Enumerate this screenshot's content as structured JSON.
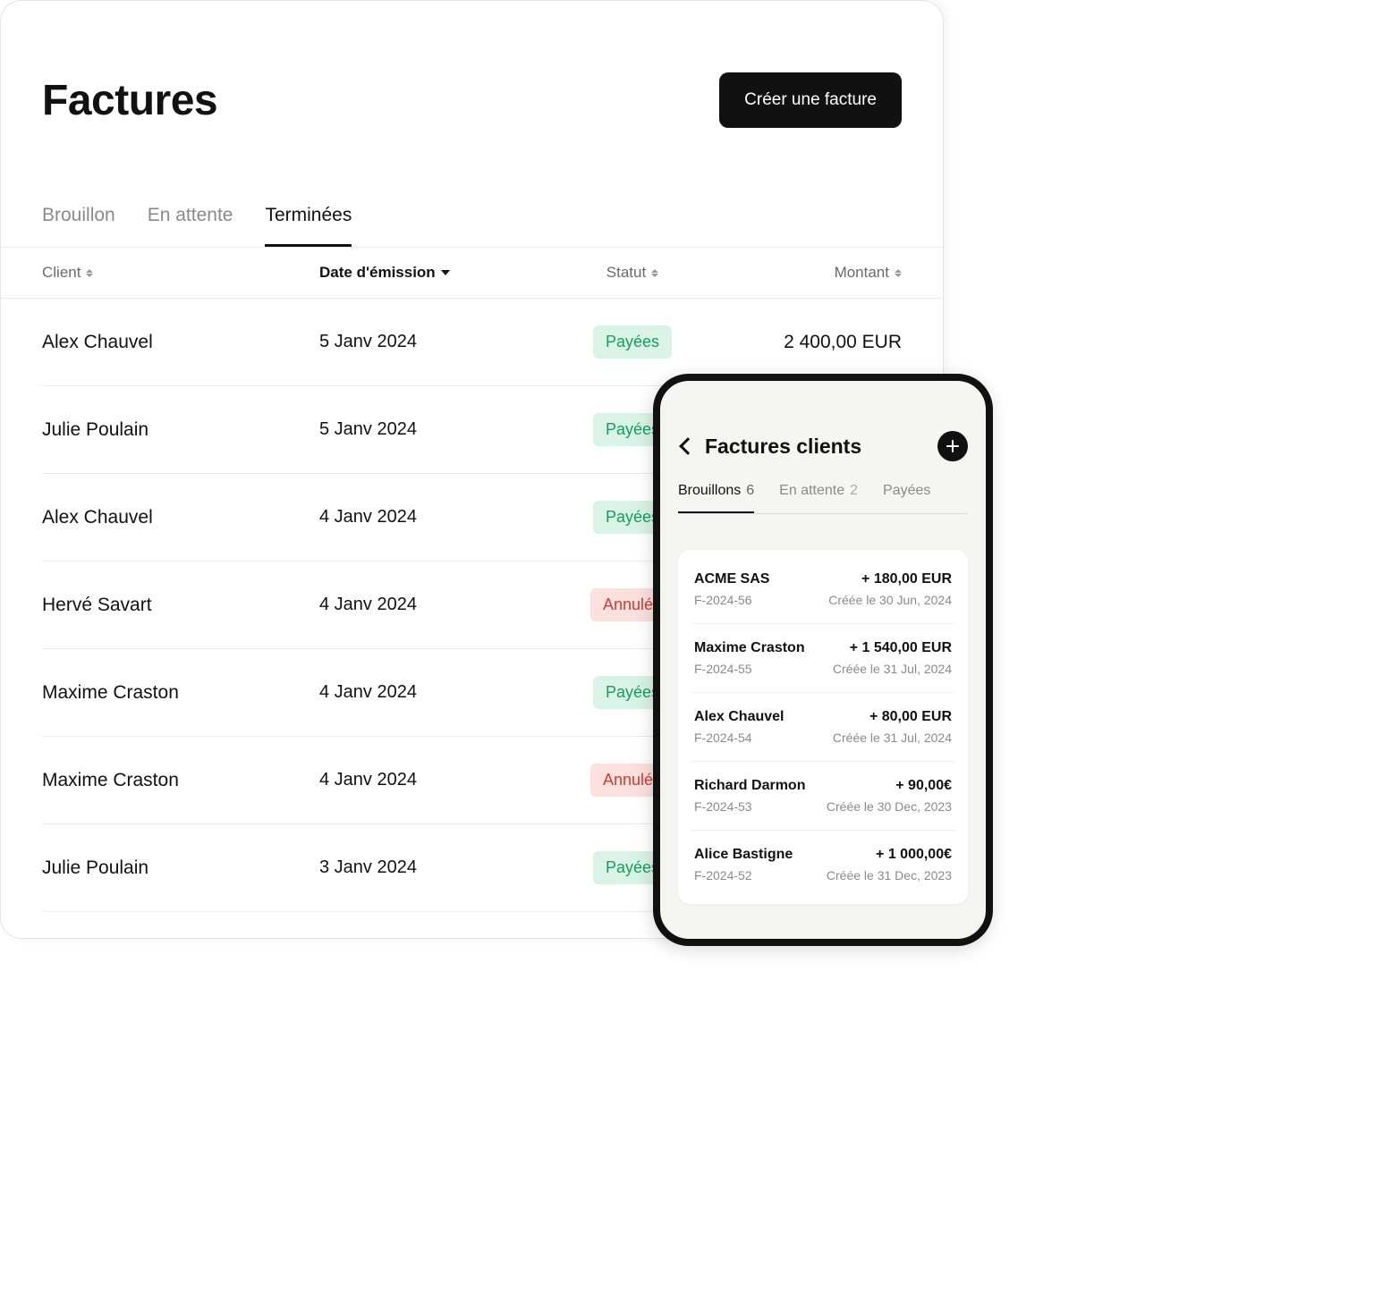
{
  "desktop": {
    "title": "Factures",
    "create_button": "Créer une facture",
    "tabs": [
      {
        "label": "Brouillon",
        "active": false
      },
      {
        "label": "En attente",
        "active": false
      },
      {
        "label": "Terminées",
        "active": true
      }
    ],
    "columns": {
      "client": "Client",
      "date": "Date d'émission",
      "status": "Statut",
      "amount": "Montant"
    },
    "status_labels": {
      "paid": "Payées",
      "cancelled": "Annulée"
    },
    "rows": [
      {
        "client": "Alex Chauvel",
        "date": "5 Janv 2024",
        "status": "paid",
        "amount": "2 400,00 EUR"
      },
      {
        "client": "Julie Poulain",
        "date": "5 Janv 2024",
        "status": "paid",
        "amount": ""
      },
      {
        "client": "Alex Chauvel",
        "date": "4 Janv 2024",
        "status": "paid",
        "amount": ""
      },
      {
        "client": "Hervé Savart",
        "date": "4 Janv 2024",
        "status": "cancelled",
        "amount": ""
      },
      {
        "client": "Maxime Craston",
        "date": "4 Janv 2024",
        "status": "paid",
        "amount": ""
      },
      {
        "client": "Maxime Craston",
        "date": "4 Janv 2024",
        "status": "cancelled",
        "amount": ""
      },
      {
        "client": "Julie Poulain",
        "date": "3 Janv 2024",
        "status": "paid",
        "amount": ""
      }
    ]
  },
  "mobile": {
    "title": "Factures clients",
    "tabs": [
      {
        "label": "Brouillons",
        "count": "6",
        "active": true
      },
      {
        "label": "En attente",
        "count": "2",
        "active": false
      },
      {
        "label": "Payées",
        "count": "",
        "active": false
      }
    ],
    "rows": [
      {
        "client": "ACME SAS",
        "amount": "+ 180,00 EUR",
        "ref": "F-2024-56",
        "date": "Créée le 30 Jun, 2024"
      },
      {
        "client": "Maxime Craston",
        "amount": "+ 1 540,00 EUR",
        "ref": "F-2024-55",
        "date": "Créée le 31 Jul, 2024"
      },
      {
        "client": "Alex Chauvel",
        "amount": "+ 80,00 EUR",
        "ref": "F-2024-54",
        "date": "Créée le 31 Jul, 2024"
      },
      {
        "client": "Richard Darmon",
        "amount": "+ 90,00€",
        "ref": "F-2024-53",
        "date": "Créée le 30 Dec, 2023"
      },
      {
        "client": "Alice Bastigne",
        "amount": "+ 1 000,00€",
        "ref": "F-2024-52",
        "date": "Créée le 31 Dec, 2023"
      }
    ]
  }
}
